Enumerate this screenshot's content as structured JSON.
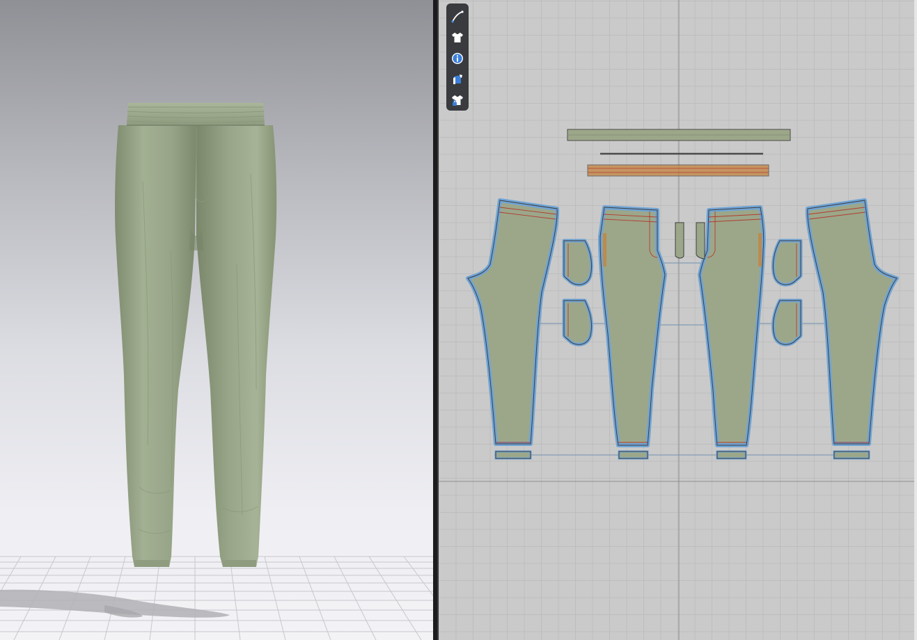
{
  "app": {
    "layout": "split-view",
    "left_panel": "3d-garment-window",
    "right_panel": "2d-pattern-window"
  },
  "colors": {
    "fabric": "#9ca78a",
    "fabric_3d_light": "#a5b295",
    "fabric_3d_shadow": "#7f8c6f",
    "piece_outline_selected": "#6fa4d6",
    "internal_line": "#b23b2f",
    "elastic_band": "#c4843f",
    "toolbar_bg": "#3a3b3f",
    "grid_bg": "#cacaca"
  },
  "toolbar": {
    "tools": [
      {
        "id": "edit-pattern",
        "icon": "pen-tool-icon",
        "tooltip": ""
      },
      {
        "id": "garment",
        "icon": "shirt-icon",
        "tooltip": ""
      },
      {
        "id": "info",
        "icon": "info-icon",
        "tooltip": ""
      },
      {
        "id": "texture",
        "icon": "texture-shirt-icon",
        "tooltip": ""
      },
      {
        "id": "lock-garment",
        "icon": "shirt-lock-icon",
        "tooltip": ""
      }
    ]
  }
}
